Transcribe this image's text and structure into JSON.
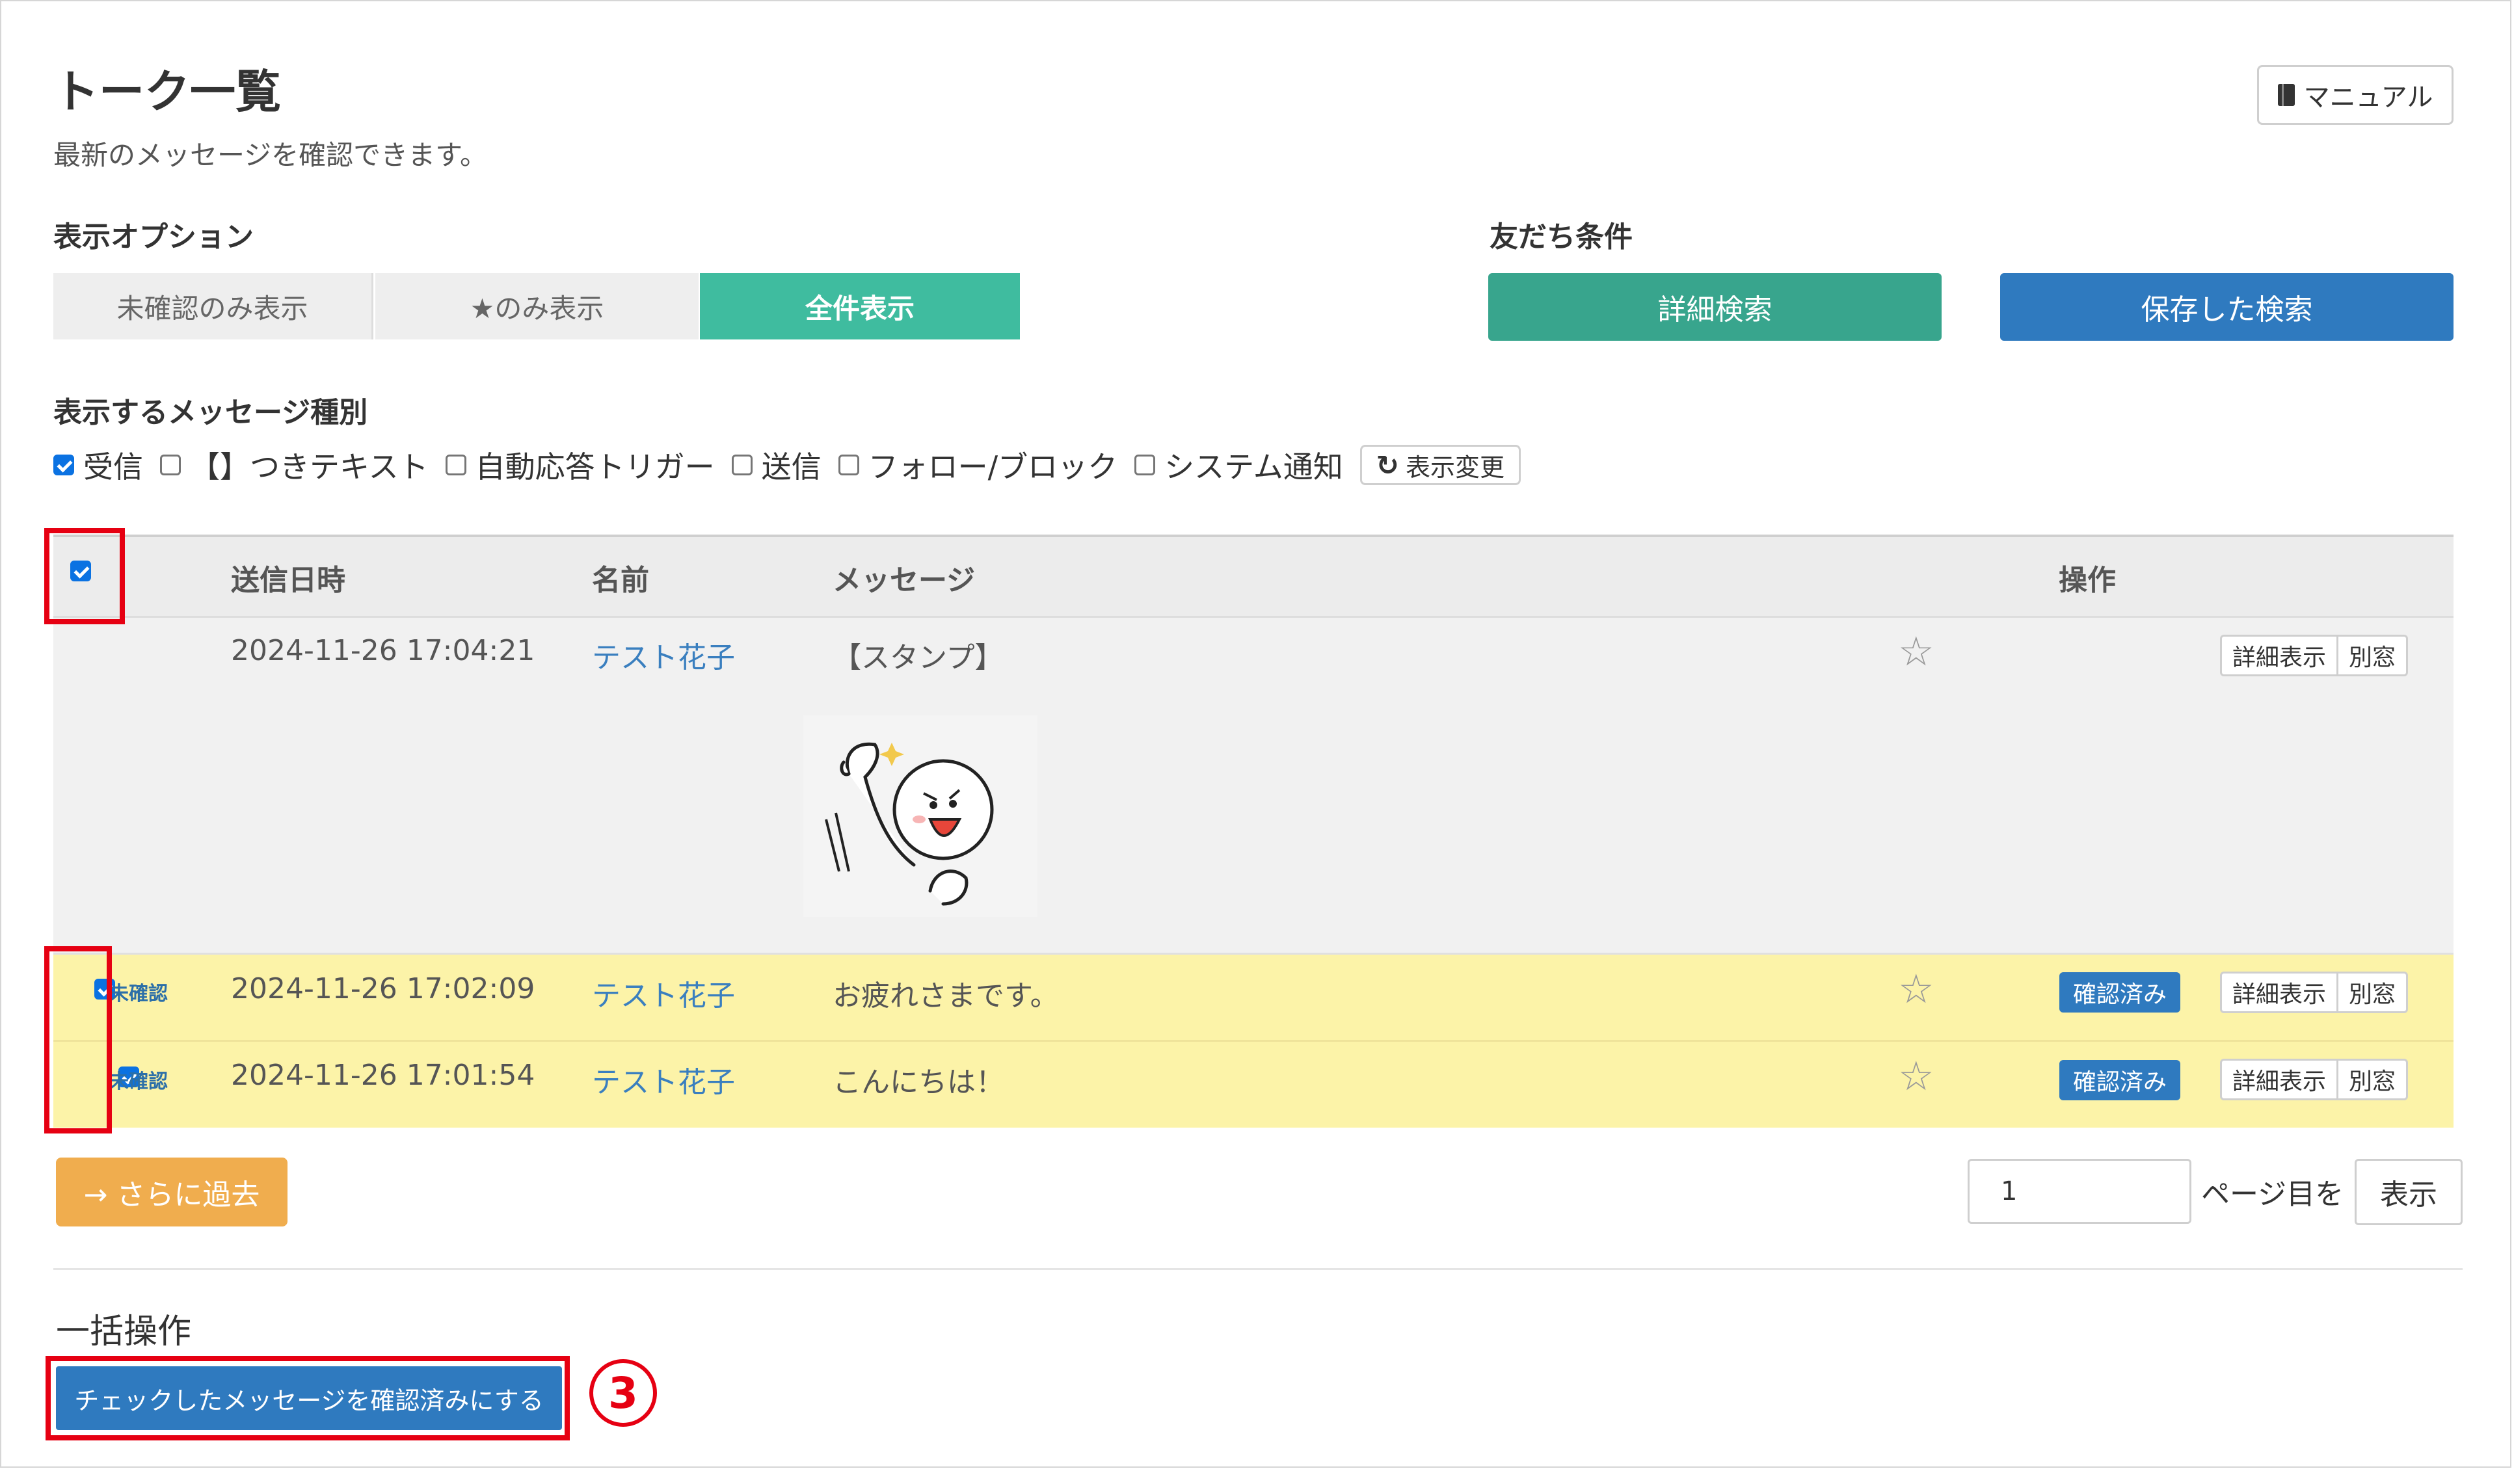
{
  "header": {
    "title": "トーク一覧",
    "subtitle": "最新のメッセージを確認できます。",
    "manual_label": "マニュアル"
  },
  "display_options": {
    "label": "表示オプション",
    "segments": [
      "未確認のみ表示",
      "★のみ表示",
      "全件表示"
    ],
    "active": "全件表示"
  },
  "friend_conditions": {
    "label": "友だち条件",
    "detail_search": "詳細検索",
    "saved_search": "保存した検索"
  },
  "message_types": {
    "label": "表示するメッセージ種別",
    "options": [
      {
        "label": "受信",
        "checked": true
      },
      {
        "label": "【】つきテキスト",
        "checked": false
      },
      {
        "label": "自動応答トリガー",
        "checked": false
      },
      {
        "label": "送信",
        "checked": false
      },
      {
        "label": "フォロー/ブロック",
        "checked": false
      },
      {
        "label": "システム通知",
        "checked": false
      }
    ],
    "refresh_label": "表示変更",
    "refresh_icon": "refresh-icon"
  },
  "table": {
    "headers": {
      "sent_at": "送信日時",
      "name": "名前",
      "message": "メッセージ",
      "actions": "操作"
    },
    "header_checkbox_checked": true,
    "rows": [
      {
        "checked": false,
        "unconfirmed": "",
        "sent_at": "2024-11-26 17:04:21",
        "name": "テスト花子",
        "message": "【スタンプ】",
        "confirm": "",
        "detail": "詳細表示",
        "window": "別窓"
      },
      {
        "checked": true,
        "unconfirmed": "未確認",
        "sent_at": "2024-11-26 17:02:09",
        "name": "テスト花子",
        "message": "お疲れさまです。",
        "confirm": "確認済み",
        "detail": "詳細表示",
        "window": "別窓"
      },
      {
        "checked": true,
        "unconfirmed": "未確認",
        "sent_at": "2024-11-26 17:01:54",
        "name": "テスト花子",
        "message": "こんにちは！",
        "confirm": "確認済み",
        "detail": "詳細表示",
        "window": "別窓"
      }
    ],
    "star_icon": "star-outline-icon"
  },
  "pagination": {
    "past_label": "→ さらに過去",
    "page_value": "1",
    "page_suffix": "ページ目を",
    "show_label": "表示"
  },
  "bulk": {
    "label": "一括操作",
    "mark_confirmed_label": "チェックしたメッセージを確認済みにする",
    "step_marker": "3"
  },
  "colors": {
    "teal": "#3fbc9f",
    "blue": "#2f7abf",
    "unread_row": "#fcf3a8",
    "orange": "#f0ad4e",
    "highlight": "#e60012"
  }
}
